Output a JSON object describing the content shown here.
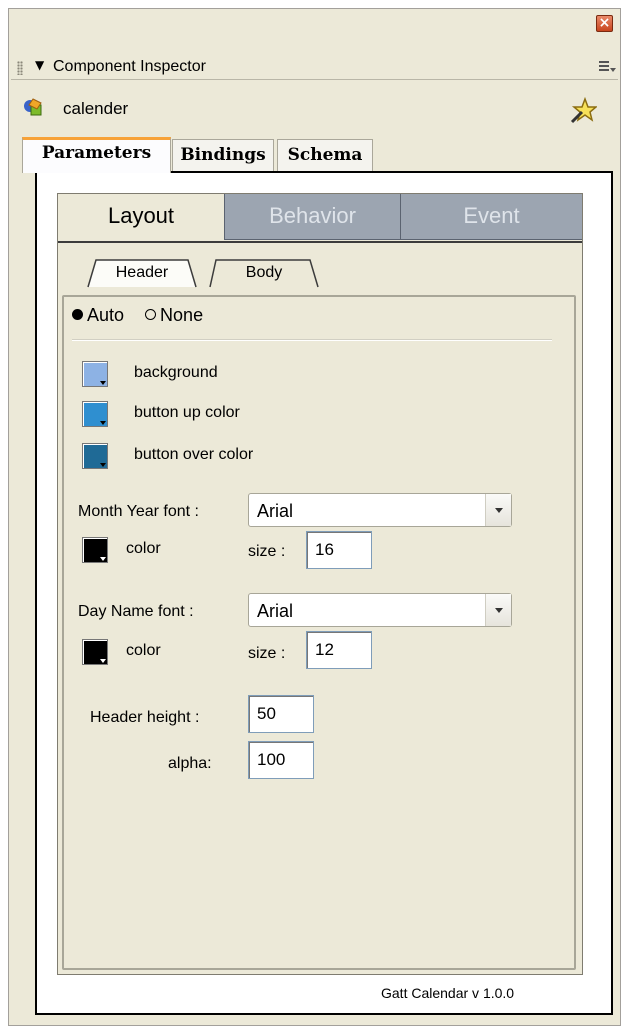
{
  "window": {
    "close_glyph": "×"
  },
  "titlebar": {
    "collapse_glyph": "▼",
    "title": "Component Inspector"
  },
  "component": {
    "name": "calender"
  },
  "tabs": [
    {
      "label": "Parameters"
    },
    {
      "label": "Bindings"
    },
    {
      "label": "Schema"
    }
  ],
  "layout_tabs": [
    {
      "label": "Layout"
    },
    {
      "label": "Behavior"
    },
    {
      "label": "Event"
    }
  ],
  "sub_tabs": [
    {
      "label": "Header"
    },
    {
      "label": "Body"
    }
  ],
  "mode": {
    "options": [
      {
        "label": "Auto",
        "selected": true
      },
      {
        "label": "None",
        "selected": false
      }
    ]
  },
  "colors": [
    {
      "label": "background",
      "value": "#8db2e4"
    },
    {
      "label": "button up color",
      "value": "#2f8fd0"
    },
    {
      "label": "button over color",
      "value": "#1f6a96"
    }
  ],
  "month_year": {
    "label": "Month Year font :",
    "font": "Arial",
    "color_label": "color",
    "color": "#000000",
    "size_label": "size :",
    "size": "16"
  },
  "day_name": {
    "label": "Day Name font :",
    "font": "Arial",
    "color_label": "color",
    "color": "#000000",
    "size_label": "size :",
    "size": "12"
  },
  "header_height": {
    "label": "Header height :",
    "value": "50"
  },
  "alpha": {
    "label": "alpha:",
    "value": "100"
  },
  "footer": {
    "version": "Gatt Calendar v 1.0.0"
  },
  "icons": [
    "close-icon",
    "grip-icon",
    "collapse-arrow-icon",
    "panel-menu-icon",
    "component-icon",
    "star-wand-icon",
    "color-dropdown-icon",
    "select-arrow-icon"
  ]
}
